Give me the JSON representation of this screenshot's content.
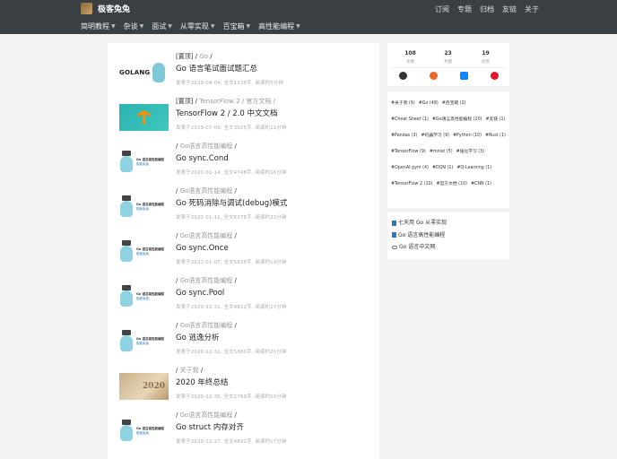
{
  "site": {
    "name": "极客兔兔",
    "top_links": [
      "订阅",
      "专题",
      "归档",
      "友链",
      "关于"
    ],
    "menu": [
      "简明教程",
      "杂谈",
      "面试",
      "从零实现",
      "百宝箱",
      "高性能编程"
    ]
  },
  "posts": [
    {
      "prefix": "[置顶] / ",
      "category": "Go",
      "suffix": " /",
      "title": "Go 语言笔试面试题汇总",
      "meta": "发表于2020-09-04,    全文1336字,    阅读约5分钟",
      "thumb": "golang"
    },
    {
      "prefix": "[置顶] / ",
      "category": "TensorFlow 2",
      "suffix": " / 官方文档 /",
      "title": "TensorFlow 2 / 2.0 中文文档",
      "meta": "发表于2019-07-09,    全文3025字,    阅读约11分钟",
      "thumb": "tensorflow"
    },
    {
      "prefix": "/ ",
      "category": "Go语言高性能编程",
      "suffix": " /",
      "title": "Go sync.Cond",
      "meta": "发表于2021-01-14,    全文4748字,    阅读约16分钟",
      "thumb": "gopher"
    },
    {
      "prefix": "/ ",
      "category": "Go语言高性能编程",
      "suffix": " /",
      "title": "Go 死码消除与调试(debug)模式",
      "meta": "发表于2021-01-11,    全文6378字,    阅读约22分钟",
      "thumb": "gopher"
    },
    {
      "prefix": "/ ",
      "category": "Go语言高性能编程",
      "suffix": " /",
      "title": "Go sync.Once",
      "meta": "发表于2021-01-07,    全文5826字,    阅读约19分钟",
      "thumb": "gopher"
    },
    {
      "prefix": "/ ",
      "category": "Go语言高性能编程",
      "suffix": " /",
      "title": "Go sync.Pool",
      "meta": "发表于2020-12-31,    全文4812字,    阅读约17分钟",
      "thumb": "gopher"
    },
    {
      "prefix": "/ ",
      "category": "Go语言高性能编程",
      "suffix": " /",
      "title": "Go 逃逸分析",
      "meta": "发表于2020-12-31,    全文5880字,    阅读约20分钟",
      "thumb": "gopher"
    },
    {
      "prefix": "/ ",
      "category": "关于我",
      "suffix": " /",
      "title": "2020 年终总结",
      "meta": "发表于2020-12-30,    全文2769字,    阅读约10分钟",
      "thumb": "year2020"
    },
    {
      "prefix": "/ ",
      "category": "Go语言高性能编程",
      "suffix": " /",
      "title": "Go struct 内存对齐",
      "meta": "发表于2020-12-27,    全文4892字,    阅读约17分钟",
      "thumb": "gopher"
    }
  ],
  "thumbs": {
    "golang_text": "GOLANG",
    "gopher_line1": "Go 语言高性能编程",
    "gopher_line2": "极客兔兔",
    "year": "2020"
  },
  "stats": [
    {
      "num": "108",
      "label": "文章"
    },
    {
      "num": "23",
      "label": "专题"
    },
    {
      "num": "19",
      "label": "标签"
    }
  ],
  "social_icons": [
    "github-icon",
    "rss-icon",
    "zhihu-icon",
    "weibo-icon"
  ],
  "tags": [
    "#关于我 (9)",
    "#Go (48)",
    "#百宝箱 (2)",
    "#Cheat Sheet (1)",
    "#Go语言高性能编程 (20)",
    "#友链 (1)",
    "#Pandas (3)",
    "#机器学习 (9)",
    "#Python (10)",
    "#Rust (1)",
    "#TensorFlow (9)",
    "#mnist (5)",
    "#强化学习 (3)",
    "#OpenAI gym (4)",
    "#DQN (1)",
    "#Q-Learning (1)",
    "#TensorFlow 2 (10)",
    "#官方文档 (10)",
    "#CNN (1)"
  ],
  "links": [
    {
      "icon": "book-icon",
      "label": "七天用 Go 从零实现"
    },
    {
      "icon": "book-icon",
      "label": "Go 语言高性能编程"
    },
    {
      "icon": "link-icon",
      "label": "Go 语言中文网"
    }
  ]
}
